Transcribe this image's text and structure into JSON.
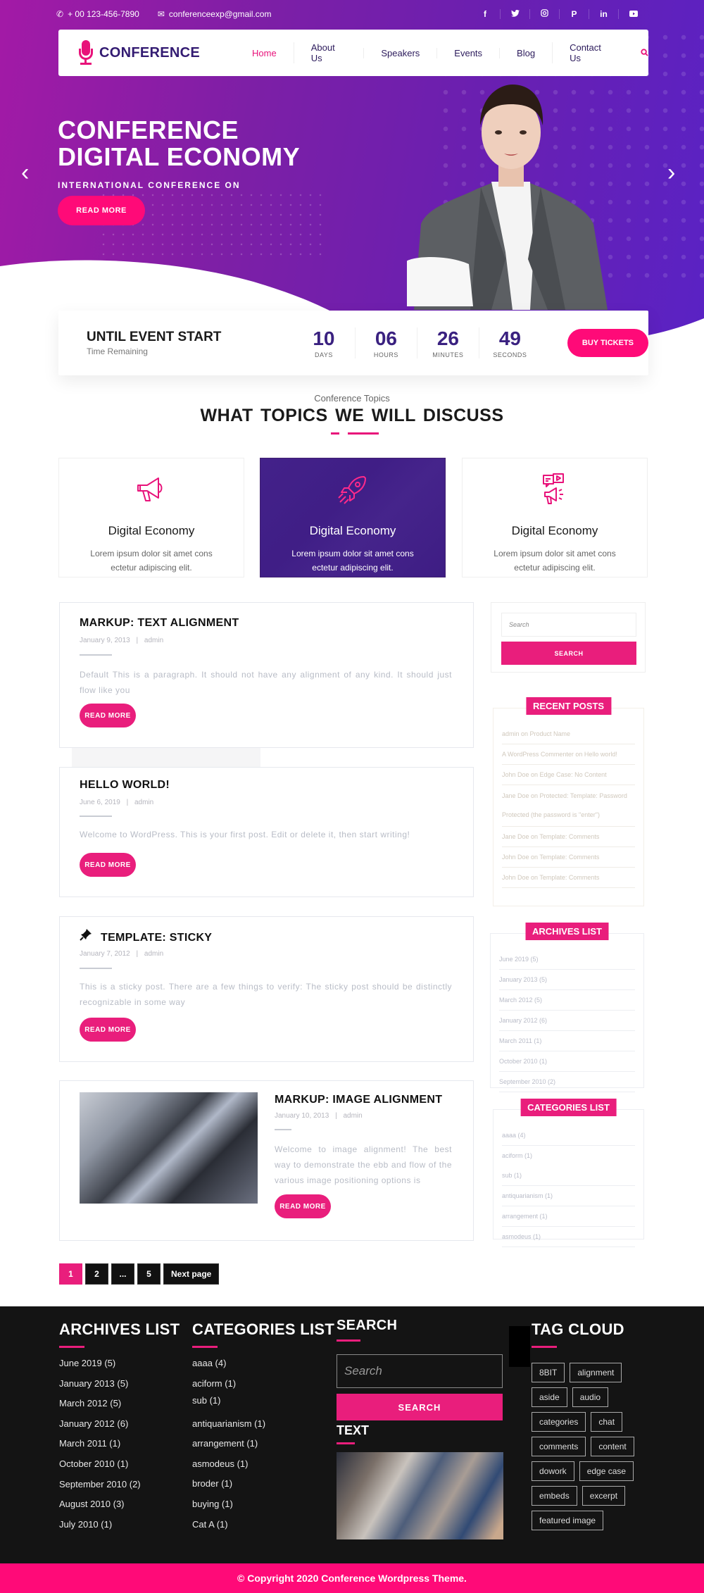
{
  "topbar": {
    "phone": "+ 00 123-456-7890",
    "email": "conferenceexp@gmail.com",
    "socials": [
      {
        "name": "facebook",
        "glyph": "f"
      },
      {
        "name": "twitter",
        "glyph": "t"
      },
      {
        "name": "instagram",
        "glyph": "◎"
      },
      {
        "name": "pinterest",
        "glyph": "P"
      },
      {
        "name": "linkedin",
        "glyph": "in"
      },
      {
        "name": "youtube",
        "glyph": "▶"
      }
    ]
  },
  "nav": {
    "logo_text": "CONFERENCE",
    "items": [
      "Home",
      "About Us",
      "Speakers",
      "Events",
      "Blog",
      "Contact Us"
    ],
    "active": "Home"
  },
  "hero": {
    "title_line1": "CONFERENCE",
    "title_line2": "DIGITAL ECONOMY",
    "subtitle": "INTERNATIONAL CONFERENCE ON",
    "button": "READ MORE",
    "prev": "‹",
    "next": "›"
  },
  "countdown": {
    "title": "UNTIL EVENT START",
    "subtitle": "Time Remaining",
    "units": [
      {
        "value": "10",
        "label": "DAYS"
      },
      {
        "value": "06",
        "label": "HOURS"
      },
      {
        "value": "26",
        "label": "MINUTES"
      },
      {
        "value": "49",
        "label": "SECONDS"
      }
    ],
    "button": "BUY TICKETS"
  },
  "topics": {
    "kicker": "Conference Topics",
    "title": "WHAT TOPICS  WE WILL DISCUSS",
    "cards": [
      {
        "icon": "megaphone",
        "title": "Digital Economy",
        "desc1": "Lorem ipsum dolor sit amet cons",
        "desc2": "ectetur adipiscing elit."
      },
      {
        "icon": "rocket",
        "title": "Digital Economy",
        "desc1": "Lorem ipsum dolor sit amet cons",
        "desc2": "ectetur adipiscing elit."
      },
      {
        "icon": "video-megaphone",
        "title": "Digital Economy",
        "desc1": "Lorem ipsum dolor sit amet cons",
        "desc2": "ectetur adipiscing elit."
      }
    ]
  },
  "posts": [
    {
      "title": "MARKUP: TEXT ALIGNMENT",
      "date": "January 9, 2013",
      "author": "admin",
      "excerpt": "Default This is a paragraph. It should not have any alignment of any kind. It should just flow like you",
      "button": "READ MORE"
    },
    {
      "title": "HELLO WORLD!",
      "date": "June 6, 2019",
      "author": "admin",
      "excerpt": "Welcome to WordPress. This is your first post. Edit or delete it, then start writing!",
      "button": "READ MORE"
    },
    {
      "title": "TEMPLATE: STICKY",
      "date": "January 7, 2012",
      "author": "admin",
      "excerpt": "This is a sticky post. There are a few things to verify: The sticky post should be distinctly recognizable in some way",
      "button": "READ MORE"
    },
    {
      "title": "MARKUP: IMAGE ALIGNMENT",
      "date": "January 10, 2013",
      "author": "admin",
      "excerpt": "Welcome to image alignment! The best way to demonstrate the ebb and flow of the various image positioning options is",
      "button": "READ MORE"
    }
  ],
  "meta_separator": "|",
  "pagination": {
    "pages": [
      "1",
      "2",
      "...",
      "5"
    ],
    "current": "1",
    "next": "Next page"
  },
  "sidebar": {
    "search_placeholder": "Search",
    "search_button": "SEARCH",
    "recent_posts": {
      "title": "RECENT POSTS",
      "items": [
        "admin on Product Name",
        "A WordPress Commenter on Hello world!",
        "John Doe on Edge Case: No Content",
        "Jane Doe on Protected: Template: Password Protected (the password is \"enter\")",
        "Jane Doe on Template: Comments",
        "John Doe on Template: Comments",
        "John Doe on Template: Comments"
      ]
    },
    "archives": {
      "title": "ARCHIVES LIST",
      "items": [
        "June 2019 (5)",
        "January 2013 (5)",
        "March 2012 (5)",
        "January 2012 (6)",
        "March 2011 (1)",
        "October 2010 (1)",
        "September 2010 (2)"
      ]
    },
    "categories": {
      "title": "CATEGORIES LIST",
      "items": [
        "aaaa (4)",
        "aciform (1)",
        "sub (1)",
        "antiquarianism (1)",
        "arrangement (1)",
        "asmodeus (1)"
      ]
    }
  },
  "footer": {
    "archives": {
      "title": "ARCHIVES LIST",
      "items": [
        "June 2019 (5)",
        "January 2013 (5)",
        "March 2012 (5)",
        "January 2012 (6)",
        "March 2011 (1)",
        "October 2010 (1)",
        "September 2010 (2)",
        "August 2010 (3)",
        "July 2010 (1)"
      ]
    },
    "categories": {
      "title": "CATEGORIES LIST",
      "items": [
        "aaaa (4)",
        "aciform (1)",
        "sub (1)",
        "antiquarianism (1)",
        "arrangement (1)",
        "asmodeus (1)",
        "broder (1)",
        "buying (1)",
        "Cat A (1)"
      ]
    },
    "search": {
      "title": "SEARCH",
      "placeholder": "Search",
      "button": "SEARCH"
    },
    "text": {
      "title": "TEXT"
    },
    "tag_cloud": {
      "title": "TAG CLOUD",
      "tags": [
        "8BIT",
        "alignment",
        "aside",
        "audio",
        "categories",
        "chat",
        "comments",
        "content",
        "dowork",
        "edge case",
        "embeds",
        "excerpt",
        "featured image"
      ]
    },
    "copyright": "© Copyright 2020 Conference Wordpress Theme."
  },
  "colors": {
    "accent": "#e91e7c",
    "hot_pink": "#ff0a78",
    "brand_purple": "#331b72",
    "hero_start": "#a31aa6",
    "hero_end": "#5a22c4",
    "footer_bg": "#141414"
  }
}
